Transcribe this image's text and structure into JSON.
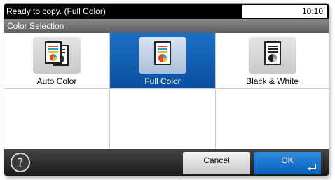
{
  "status_bar": {
    "message": "Ready to copy. (Full Color)",
    "time": "10:10"
  },
  "header": {
    "title": "Color Selection"
  },
  "options": [
    {
      "label": "Auto Color",
      "icon": "auto-color-icon",
      "selected": false
    },
    {
      "label": "Full Color",
      "icon": "full-color-icon",
      "selected": true
    },
    {
      "label": "Black & White",
      "icon": "black-white-icon",
      "selected": false
    }
  ],
  "footer": {
    "help_icon": "help-icon",
    "cancel_label": "Cancel",
    "ok_label": "OK",
    "ok_icon": "enter-icon"
  },
  "colors": {
    "selected": "#1563b8",
    "status_bar": "#000000",
    "header": "#707070"
  }
}
